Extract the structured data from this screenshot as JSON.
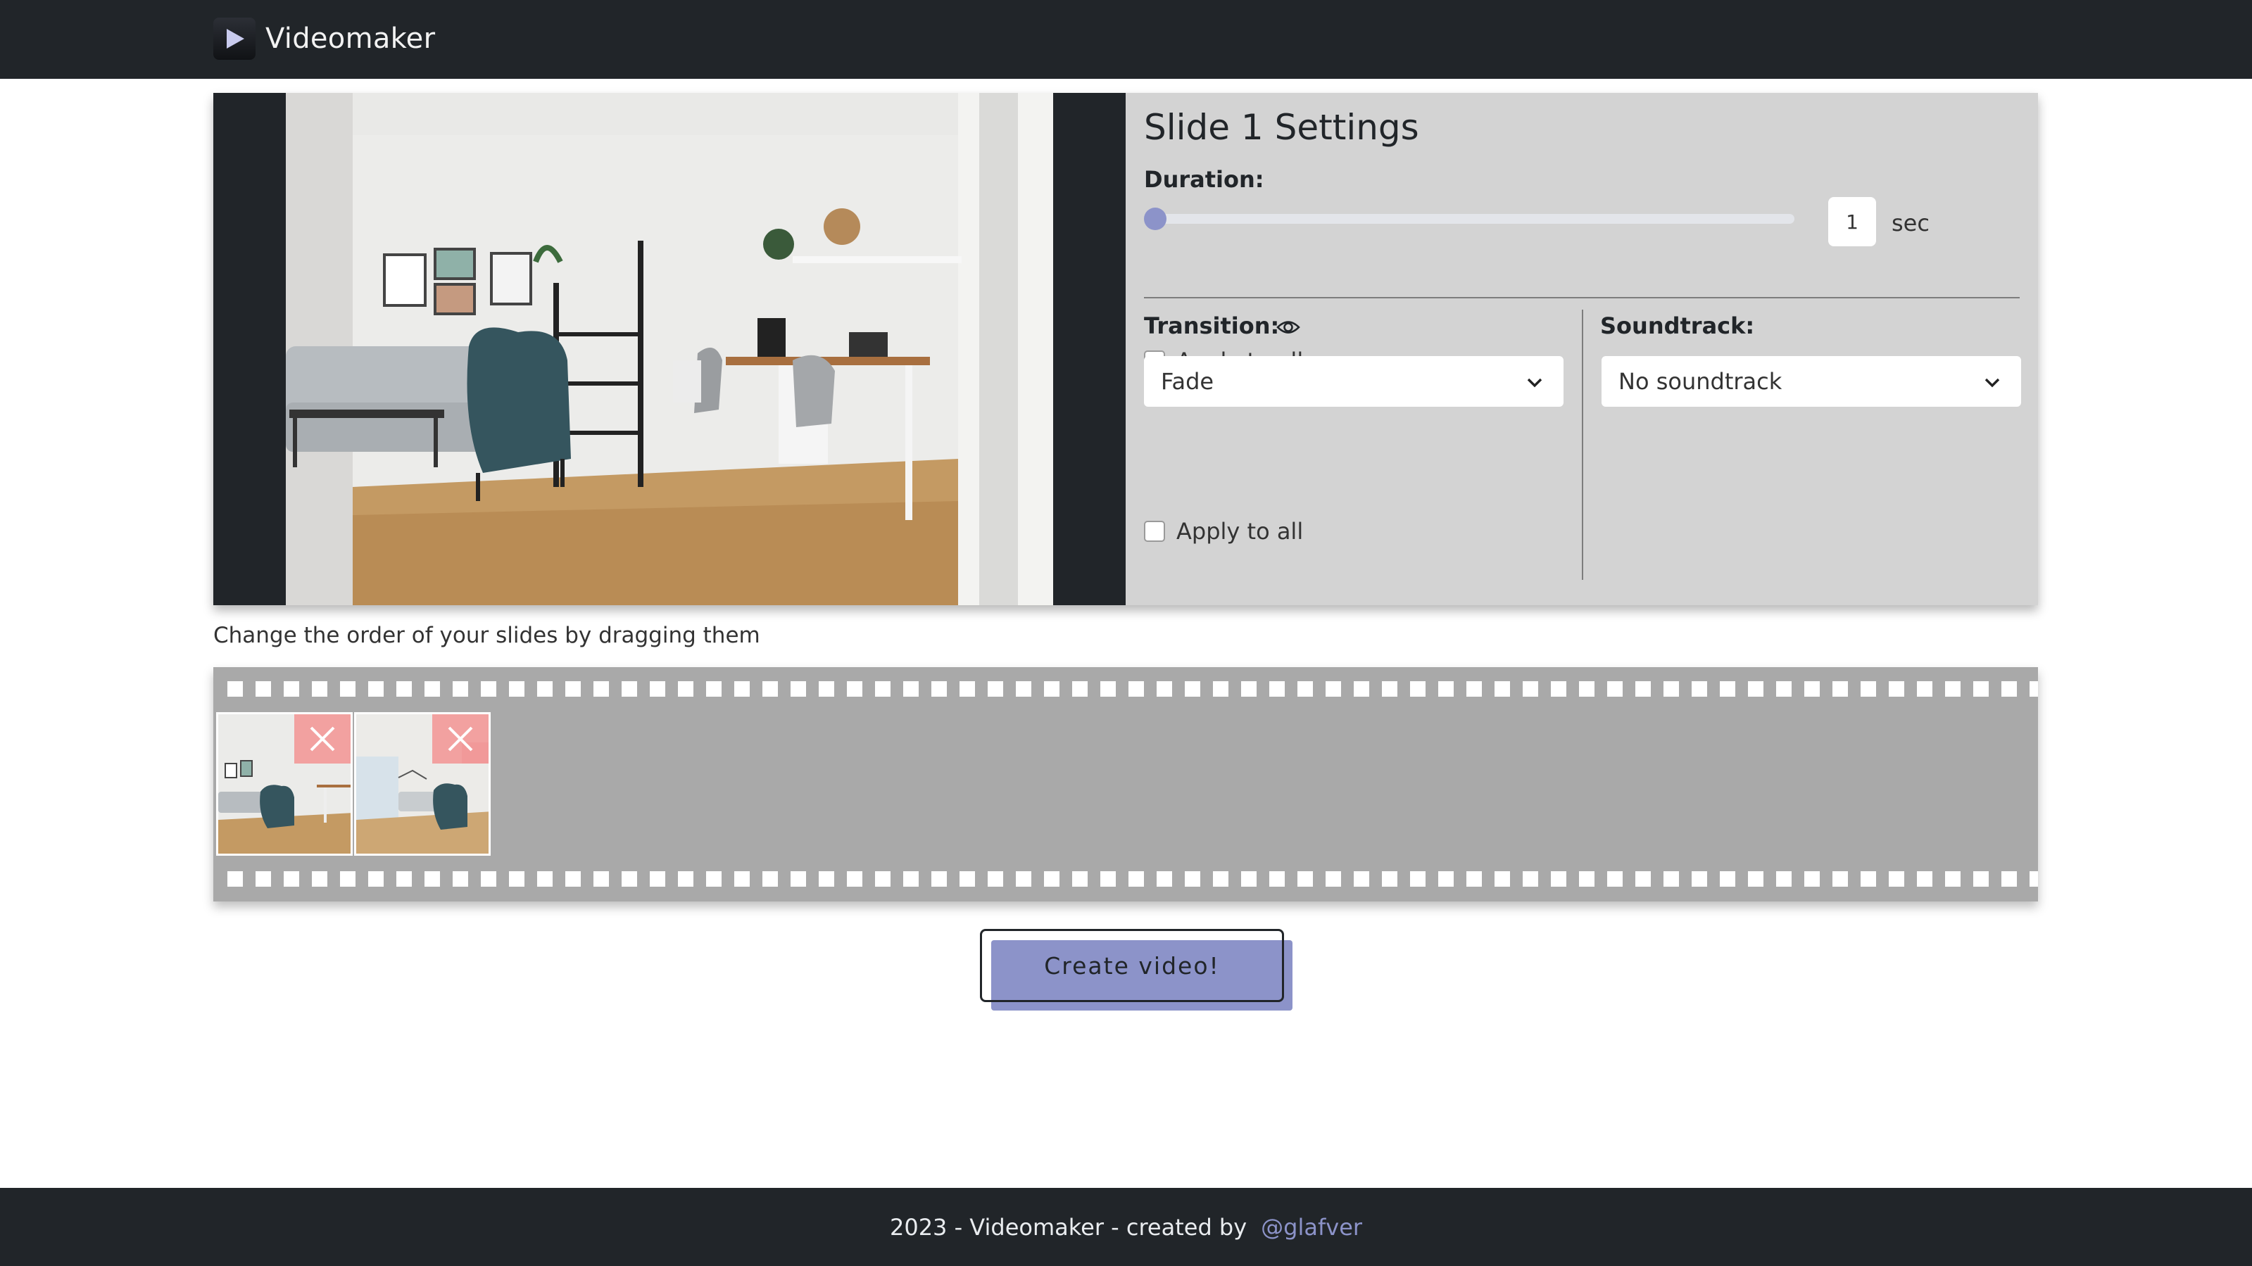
{
  "app": {
    "title": "Videomaker"
  },
  "settings": {
    "title": "Slide 1 Settings",
    "duration_label": "Duration:",
    "duration_value": "1",
    "duration_unit": "sec",
    "duration_slider_fraction": 0.0,
    "apply_all_label": "Apply to all",
    "transition_label": "Transition:",
    "transition_value": "Fade",
    "soundtrack_label": "Soundtrack:",
    "soundtrack_value": "No soundtrack"
  },
  "hint": "Change the order of your slides by dragging them",
  "slides": [
    {
      "remove_icon": "close-icon"
    },
    {
      "remove_icon": "close-icon"
    }
  ],
  "create_button": "Create video!",
  "footer": {
    "text": "2023 - Videomaker - created by",
    "link": "@glafver"
  },
  "colors": {
    "accent": "#8c93c9",
    "dark": "#212529",
    "panel": "#d3d3d3",
    "filmstrip": "#a9a9a9",
    "remove_overlay": "#f38c8c"
  }
}
